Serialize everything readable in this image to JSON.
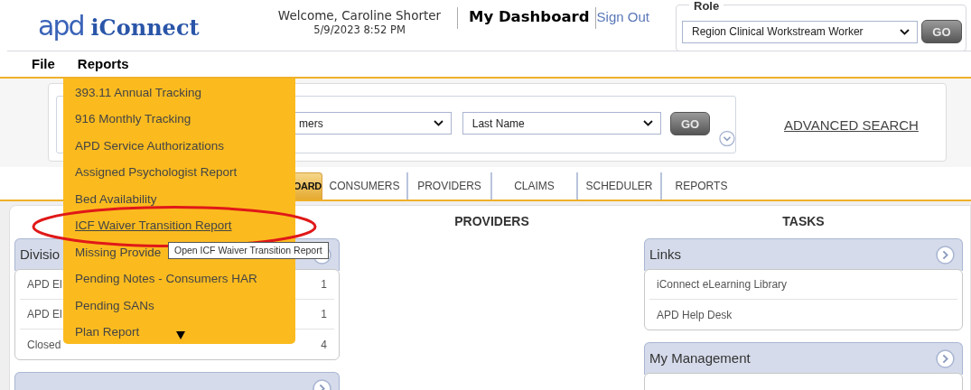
{
  "header": {
    "logo_mark": "apd",
    "logo_name": "iConnect",
    "welcome": "Welcome, Caroline Shorter",
    "datetime": "5/9/2023 8:52 PM",
    "title": "My Dashboard",
    "sign_out": "Sign Out"
  },
  "role": {
    "legend": "Role",
    "value": "Region Clinical Workstream Worker",
    "button": "GO"
  },
  "menu_bar": [
    {
      "label": "File"
    },
    {
      "label": "Reports"
    }
  ],
  "search": {
    "category_value": "mers",
    "field_value": "Last Name",
    "button": "GO",
    "advanced_link": "ADVANCED SEARCH"
  },
  "tabs": [
    {
      "label": "OARD",
      "selected": true
    },
    {
      "label": "CONSUMERS",
      "selected": false
    },
    {
      "label": "PROVIDERS",
      "selected": false
    },
    {
      "label": "CLAIMS",
      "selected": false
    },
    {
      "label": "SCHEDULER",
      "selected": false
    },
    {
      "label": "REPORTS",
      "selected": false
    }
  ],
  "columns": [
    {
      "panels": [
        {
          "kind": "list",
          "title": "Divisio",
          "rows": [
            {
              "label": "APD El",
              "count": "1"
            },
            {
              "label": "APD El",
              "count": "1"
            },
            {
              "label": "Closed",
              "count": "4"
            }
          ]
        },
        {
          "kind": "cut-off"
        }
      ]
    },
    {
      "heading": "PROVIDERS"
    },
    {
      "heading": "TASKS",
      "panels": [
        {
          "kind": "list",
          "title": "Links",
          "rows": [
            {
              "label": "iConnect eLearning Library"
            },
            {
              "label": "APD Help Desk"
            }
          ]
        },
        {
          "kind": "cut-off",
          "title": "My Management"
        }
      ]
    }
  ],
  "reports_menu": {
    "items": [
      {
        "label": "393.11 Annual Tracking",
        "hovered": false,
        "circled": false
      },
      {
        "label": "916 Monthly Tracking",
        "hovered": false,
        "circled": false
      },
      {
        "label": "APD Service Authorizations",
        "hovered": false,
        "circled": false
      },
      {
        "label": "Assigned Psychologist Report",
        "hovered": false,
        "circled": false
      },
      {
        "label": "Bed Availability",
        "hovered": false,
        "circled": false
      },
      {
        "label": "ICF Waiver Transition Report",
        "hovered": true,
        "circled": true
      },
      {
        "label": "Missing Provide",
        "hovered": false,
        "circled": false
      },
      {
        "label": "Pending Notes - Consumers HAR",
        "hovered": false,
        "circled": false
      },
      {
        "label": "Pending SANs",
        "hovered": false,
        "circled": false
      },
      {
        "label": "Plan Report",
        "hovered": false,
        "circled": false
      }
    ],
    "more_below": true,
    "tooltip": "Open ICF Waiver Transition Report"
  }
}
